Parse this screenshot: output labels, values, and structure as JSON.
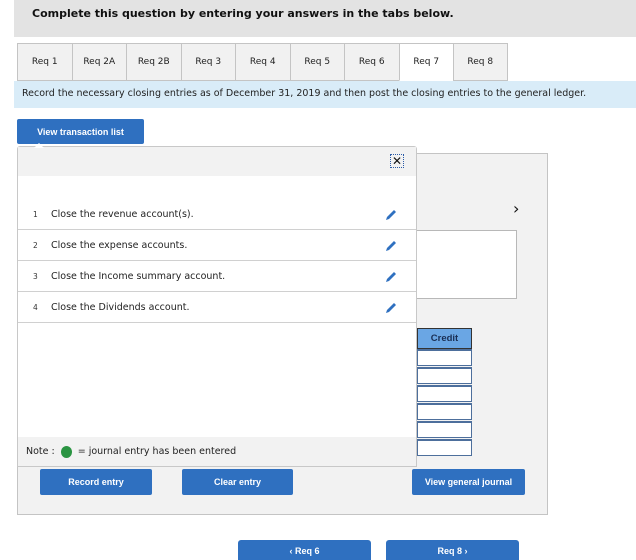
{
  "instruction": "Complete this question by entering your answers in the tabs below.",
  "tabs": [
    {
      "label": "Req 1",
      "active": false
    },
    {
      "label": "Req 2A",
      "active": false
    },
    {
      "label": "Req 2B",
      "active": false
    },
    {
      "label": "Req 3",
      "active": false
    },
    {
      "label": "Req 4",
      "active": false
    },
    {
      "label": "Req 5",
      "active": false
    },
    {
      "label": "Req 6",
      "active": false
    },
    {
      "label": "Req 7",
      "active": true
    },
    {
      "label": "Req 8",
      "active": false
    }
  ],
  "prompt": "Record the necessary closing entries as of December 31, 2019 and then post the closing entries to the general ledger.",
  "view_transaction_list_label": "View transaction list",
  "popup": {
    "close_icon": "✕",
    "transactions": [
      {
        "num": "1",
        "text": "Close the revenue account(s)."
      },
      {
        "num": "2",
        "text": "Close the expense accounts."
      },
      {
        "num": "3",
        "text": "Close the Income summary account."
      },
      {
        "num": "4",
        "text": "Close the Dividends account."
      }
    ],
    "note_prefix": "Note :",
    "note_suffix": "= journal entry has been entered"
  },
  "journal": {
    "next_icon": "›",
    "credit_header": "Credit",
    "credit_rows": 6
  },
  "buttons": {
    "record_entry": "Record entry",
    "clear_entry": "Clear entry",
    "view_general_journal": "View general journal",
    "prev": "‹  Req 6",
    "next": "Req 8  ›"
  },
  "colors": {
    "accent": "#2f70c0",
    "entered_dot": "#2a9442",
    "prompt_bg": "#d9ecf8"
  }
}
